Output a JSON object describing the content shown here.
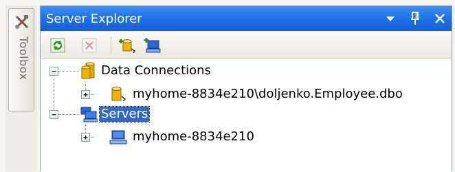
{
  "toolbox": {
    "label": "Toolbox",
    "icon": "toolbox-icon"
  },
  "window": {
    "title": "Server Explorer",
    "controls": [
      "dropdown-arrow-icon",
      "pin-icon",
      "close-icon"
    ]
  },
  "toolbar": {
    "buttons": [
      "refresh-icon",
      "stop-icon",
      "connect-to-database-icon",
      "connect-to-server-icon"
    ]
  },
  "tree": {
    "data_connections": {
      "label": "Data Connections",
      "expanded": true,
      "children": [
        {
          "label": "myhome-8834e210\\doljenko.Employee.dbo",
          "expanded": false
        }
      ]
    },
    "servers": {
      "label": "Servers",
      "expanded": true,
      "selected": true,
      "children": [
        {
          "label": "myhome-8834e210",
          "expanded": false
        }
      ]
    }
  },
  "colors": {
    "titlebar": "#1c6fe6",
    "selection": "#3169c6",
    "database_yellow": "#f0b400"
  }
}
